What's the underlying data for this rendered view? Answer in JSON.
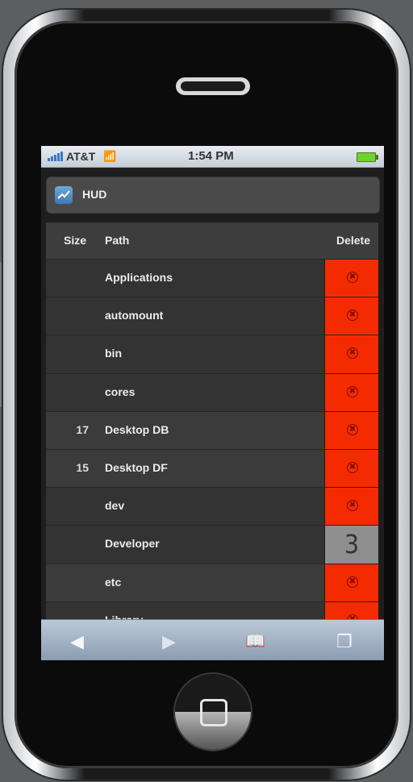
{
  "status_bar": {
    "carrier": "AT&T",
    "time": "1:54 PM",
    "wifi_icon": "wifi-icon",
    "battery_icon": "battery-icon"
  },
  "header": {
    "title": "HUD",
    "icon": "chart-icon"
  },
  "table": {
    "columns": {
      "size": "Size",
      "path": "Path",
      "delete": "Delete"
    },
    "rows": [
      {
        "size": "",
        "path": "Applications",
        "delete": "x"
      },
      {
        "size": "",
        "path": "automount",
        "delete": "x"
      },
      {
        "size": "",
        "path": "bin",
        "delete": "x"
      },
      {
        "size": "",
        "path": "cores",
        "delete": "x"
      },
      {
        "size": "17",
        "path": "Desktop DB",
        "delete": "x"
      },
      {
        "size": "15",
        "path": "Desktop DF",
        "delete": "x"
      },
      {
        "size": "",
        "path": "dev",
        "delete": "x"
      },
      {
        "size": "",
        "path": "Developer",
        "delete": "3"
      },
      {
        "size": "",
        "path": "etc",
        "delete": "x"
      },
      {
        "size": "",
        "path": "Library",
        "delete": "x"
      }
    ]
  },
  "toolbar": {
    "back_icon": "back-arrow-icon",
    "forward_icon": "forward-arrow-icon",
    "bookmarks_icon": "bookmarks-icon",
    "pages_icon": "pages-icon"
  },
  "colors": {
    "delete_red": "#f42b00",
    "counter_gray": "#8e8e8e",
    "row_dark": "#333333",
    "row_light": "#3b3b3b"
  }
}
